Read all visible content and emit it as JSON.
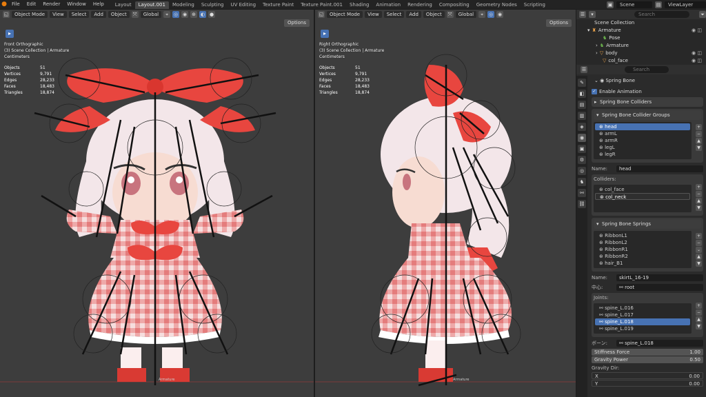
{
  "menu": [
    "File",
    "Edit",
    "Render",
    "Window",
    "Help"
  ],
  "workspace_tabs": [
    "Layout",
    "Layout.001",
    "Modeling",
    "Sculpting",
    "UV Editing",
    "Texture Paint",
    "Texture Paint.001",
    "Shading",
    "Animation",
    "Rendering",
    "Compositing",
    "Geometry Nodes",
    "Scripting"
  ],
  "active_tab_index": 1,
  "scene": "Scene",
  "view_layer": "ViewLayer",
  "left_view": {
    "mode": "Object Mode",
    "view": "View",
    "select": "Select",
    "add": "Add",
    "object": "Object",
    "orientation": "Global",
    "options": "Options",
    "title": "Front Orthographic",
    "collection": "(3) Scene Collection | Armature",
    "units": "Centimeters",
    "stats": [
      [
        "Objects",
        "51"
      ],
      [
        "Vertices",
        "9,791"
      ],
      [
        "Edges",
        "28,233"
      ],
      [
        "Faces",
        "18,483"
      ],
      [
        "Triangles",
        "18,874"
      ]
    ],
    "armature_label": "Armature"
  },
  "right_view": {
    "mode": "Object Mode",
    "view": "View",
    "select": "Select",
    "add": "Add",
    "object": "Object",
    "orientation": "Global",
    "options": "Options",
    "title": "Right Orthographic",
    "collection": "(3) Scene Collection | Armature",
    "units": "Centimeters",
    "stats": [
      [
        "Objects",
        "51"
      ],
      [
        "Vertices",
        "9,791"
      ],
      [
        "Edges",
        "28,233"
      ],
      [
        "Faces",
        "18,483"
      ],
      [
        "Triangles",
        "18,874"
      ]
    ],
    "armature_label": "Armature"
  },
  "outliner": {
    "search_placeholder": "Search",
    "rows": [
      {
        "label": "Scene Collection",
        "indent": 0
      },
      {
        "label": "Armature",
        "indent": 1
      },
      {
        "label": "Pose",
        "indent": 2
      },
      {
        "label": "Armature",
        "indent": 2
      },
      {
        "label": "body",
        "indent": 2
      },
      {
        "label": "col_face",
        "indent": 2
      }
    ]
  },
  "properties": {
    "search_placeholder": "Search",
    "spring_bone": "Spring Bone",
    "enable_animation": "Enable Animation",
    "colliders_panel": "Spring Bone Colliders",
    "collider_groups_panel": "Spring Bone Collider Groups",
    "collider_groups": [
      "head",
      "armL",
      "armR",
      "legL",
      "legR"
    ],
    "selected_group": "head",
    "name_label": "Name:",
    "group_name": "head",
    "colliders_label": "Colliders:",
    "colliders": [
      "col_face",
      "col_neck"
    ],
    "springs_panel": "Spring Bone Springs",
    "springs": [
      "RibbonL1",
      "RibbonL2",
      "RibbonR1",
      "RibbonR2",
      "hair_B1"
    ],
    "spring_name": "skirtL_16-19",
    "center_label": "中心:",
    "center_value": "root",
    "joints_label": "Joints:",
    "joints": [
      "spine_L.016",
      "spine_L.017",
      "spine_L.018",
      "spine_L.019"
    ],
    "selected_joint": "spine_L.018",
    "bone_label": "ボーン:",
    "bone_value": "spine_L.018",
    "stiffness_label": "Stiffness Force",
    "stiffness_value": "1.00",
    "gravity_label": "Gravity Power",
    "gravity_value": "0.50",
    "gravity_dir_label": "Gravity Dir:",
    "x_label": "X",
    "x_value": "0.00",
    "y_label": "Y",
    "y_value": "0.00"
  },
  "colors": {
    "accent": "#4772b3",
    "viewport": "#3d3d3d",
    "ribbon": "#e8463f",
    "skin": "#f5d4cc",
    "hair": "#f4e8ea"
  }
}
